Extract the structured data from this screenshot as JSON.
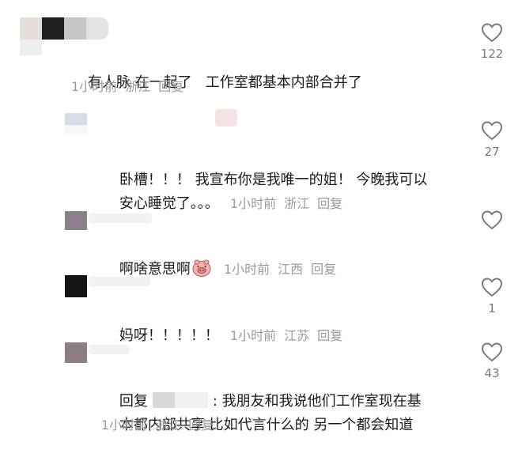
{
  "comments": [
    {
      "text_lines": [
        "有人脉 在一起了   工作室都基本内部合并了"
      ],
      "time": "1小时前",
      "location": "浙江",
      "reply": "回复",
      "likes": "122"
    },
    {
      "text_lines": [
        "卧槽！！！ 我宣布你是我唯一的姐！ 今晚我可以",
        "安心睡觉了。。。"
      ],
      "time": "1小时前",
      "location": "浙江",
      "reply": "回复",
      "likes": "27"
    },
    {
      "text_lines": [
        "啊啥意思啊"
      ],
      "emoji": "pig-face-emoji",
      "time": "1小时前",
      "location": "江西",
      "reply": "回复",
      "likes": ""
    },
    {
      "text_lines": [
        "妈呀！！！！！"
      ],
      "time": "1小时前",
      "location": "江苏",
      "reply": "回复",
      "likes": "1"
    },
    {
      "reply_prefix": "回复",
      "text_lines": [
        ": 我朋友和我说他们工作室现在基",
        "本都内部共享 比如代言什么的 另一个都会知道"
      ],
      "time": "1小时前",
      "location": "浙江",
      "reply": "回复",
      "likes": "43"
    }
  ],
  "colors": {
    "text": "#1a1a1a",
    "meta": "#9a9a9a",
    "icon": "#7a7a7a"
  }
}
